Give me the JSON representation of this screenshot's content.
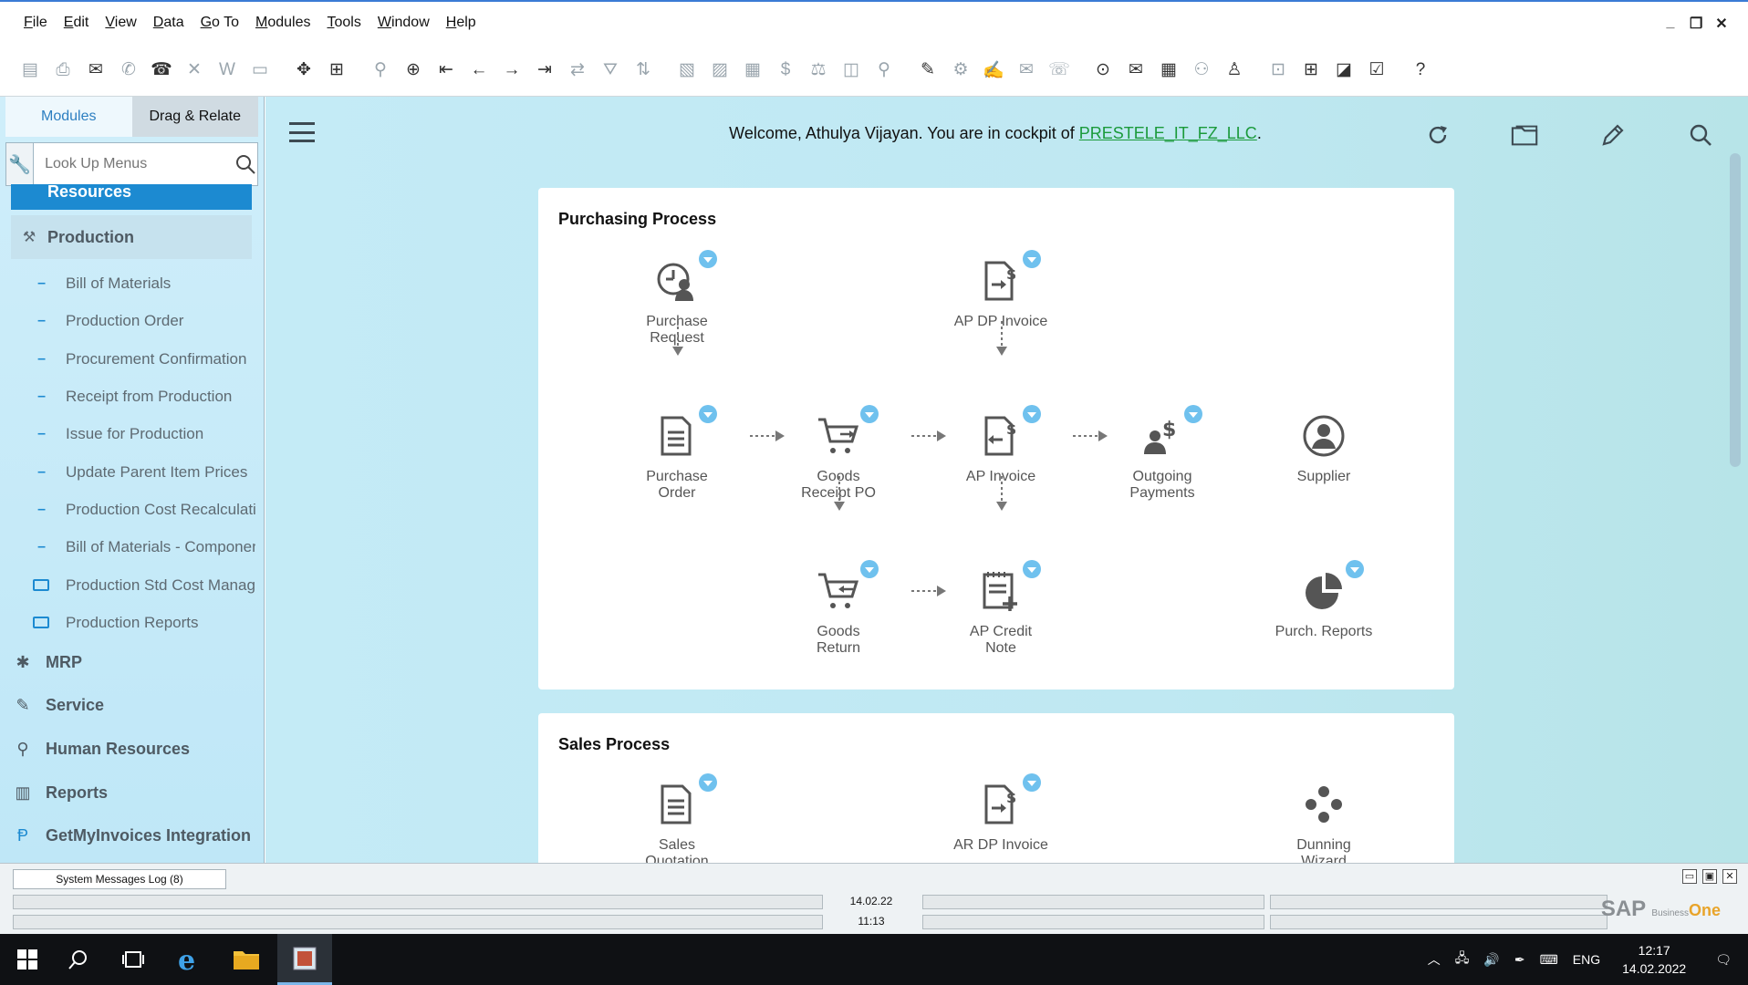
{
  "menu": [
    {
      "key": "F",
      "rest": "ile"
    },
    {
      "key": "E",
      "rest": "dit"
    },
    {
      "key": "V",
      "rest": "iew"
    },
    {
      "key": "D",
      "rest": "ata"
    },
    {
      "key": "G",
      "rest": "o To"
    },
    {
      "key": "M",
      "rest": "odules"
    },
    {
      "key": "T",
      "rest": "ools"
    },
    {
      "key": "W",
      "rest": "indow"
    },
    {
      "key": "H",
      "rest": "elp"
    }
  ],
  "window_controls": {
    "minimize": "_",
    "restore": "❐",
    "close": "✕"
  },
  "sidebar": {
    "tabs": {
      "modules": "Modules",
      "drag_relate": "Drag & Relate"
    },
    "lookup_placeholder": "Look Up Menus",
    "resources_label": "Resources",
    "production_label": "Production",
    "production_items": [
      "Bill of Materials",
      "Production Order",
      "Procurement Confirmation",
      "Receipt from Production",
      "Issue for Production",
      "Update Parent Item Prices",
      "Production Cost Recalculation",
      "Bill of Materials - Component"
    ],
    "production_folders": [
      "Production Std Cost Management",
      "Production Reports"
    ],
    "modules": [
      {
        "label": "MRP",
        "icon": "puzzle-icon"
      },
      {
        "label": "Service",
        "icon": "service-icon"
      },
      {
        "label": "Human Resources",
        "icon": "people-icon"
      },
      {
        "label": "Reports",
        "icon": "reports-icon"
      },
      {
        "label": "GetMyInvoices Integration",
        "icon": "getmyinvoices-icon"
      }
    ]
  },
  "cockpit": {
    "welcome_prefix": "Welcome, Athulya Vijayan. You are in cockpit of ",
    "company": "PRESTELE_IT_FZ_LLC",
    "welcome_suffix": "."
  },
  "purchasing": {
    "title": "Purchasing Process",
    "purchase_request": [
      "Purchase",
      "Request"
    ],
    "ap_dp_invoice": "AP DP Invoice",
    "purchase_order": [
      "Purchase",
      "Order"
    ],
    "goods_receipt_po": [
      "Goods",
      "Receipt PO"
    ],
    "ap_invoice": "AP Invoice",
    "outgoing_payments": [
      "Outgoing",
      "Payments"
    ],
    "supplier": "Supplier",
    "goods_return": [
      "Goods",
      "Return"
    ],
    "ap_credit_note": [
      "AP Credit",
      "Note"
    ],
    "purch_reports": "Purch. Reports"
  },
  "sales": {
    "title": "Sales Process",
    "sales_quotation": [
      "Sales",
      "Quotation"
    ],
    "ar_dp_invoice": "AR DP Invoice",
    "dunning_wizard": [
      "Dunning",
      "Wizard"
    ]
  },
  "bottom": {
    "messages_tab": "System Messages Log (8)",
    "date": "14.02.22",
    "time": "11:13",
    "logo_sap": "SAP",
    "logo_business": "Business",
    "logo_one": "One"
  },
  "taskbar": {
    "language": "ENG",
    "clock_time": "12:17",
    "clock_date": "14.02.2022"
  },
  "colors": {
    "accent": "#1c8ad1",
    "link": "#1a9a3a",
    "badge": "#6fc1ee"
  }
}
